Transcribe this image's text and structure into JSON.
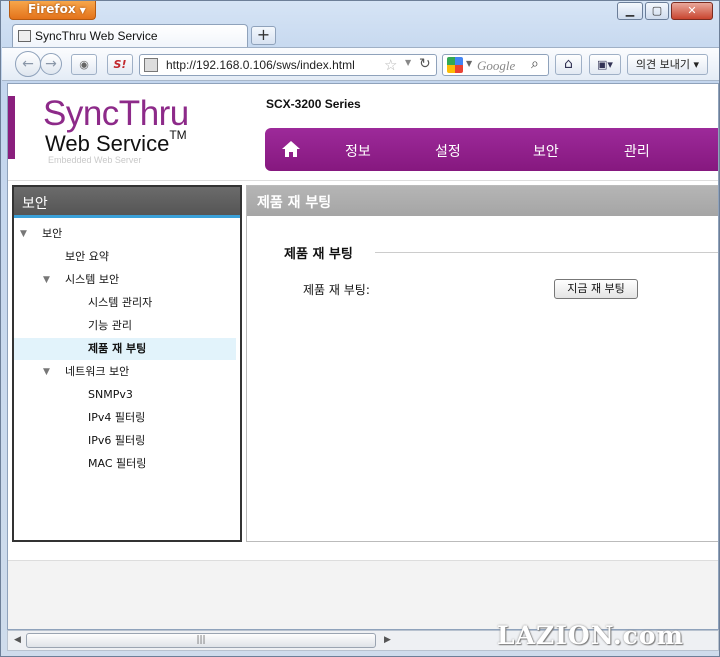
{
  "browser": {
    "app_button": "Firefox",
    "tab_title": "SyncThru Web Service",
    "new_tab": "+",
    "url": "http://192.168.0.106/sws/index.html",
    "search_placeholder": "Google",
    "feedback_button": "의견 보내기"
  },
  "header": {
    "logo_main": "SyncThru",
    "logo_second": "Web Service",
    "logo_tm": "TM",
    "logo_sub": "Embedded Web Server",
    "model": "SCX-3200 Series",
    "menu": [
      "정보",
      "설정",
      "보안",
      "관리"
    ]
  },
  "sidebar": {
    "title": "보안",
    "items": [
      {
        "label": "보안"
      },
      {
        "label": "보안 요약"
      },
      {
        "label": "시스템 보안"
      },
      {
        "label": "시스템 관리자"
      },
      {
        "label": "기능 관리"
      },
      {
        "label": "제품 재 부팅"
      },
      {
        "label": "네트워크 보안"
      },
      {
        "label": "SNMPv3"
      },
      {
        "label": "IPv4 필터링"
      },
      {
        "label": "IPv6 필터링"
      },
      {
        "label": "MAC 필터링"
      }
    ]
  },
  "main": {
    "title": "제품 재 부팅",
    "section_title": "제품 재 부팅",
    "reboot_label": "제품 재 부팅:",
    "reboot_button": "지금 재 부팅"
  },
  "watermark": "LAZION.com",
  "colors": {
    "brand_purple": "#8d2a89",
    "menu_purple": "#9d2a9a",
    "selected_row": "#e2f3fb",
    "firefox_orange": "#e3731b"
  }
}
